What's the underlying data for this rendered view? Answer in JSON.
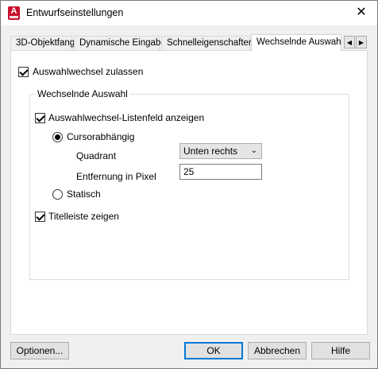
{
  "window": {
    "title": "Entwurfseinstellungen",
    "app_icon_letter": "A",
    "close_symbol": "✕"
  },
  "tabs": [
    {
      "label": "3D-Objektfang",
      "active": false
    },
    {
      "label": "Dynamische Eingabe",
      "active": false
    },
    {
      "label": "Schnelleigenschaften",
      "active": false
    },
    {
      "label": "Wechselnde Auswahl",
      "active": true
    }
  ],
  "tab_scroll": {
    "left": "◀",
    "right": "▶"
  },
  "main": {
    "enable_checkbox": {
      "label": "Auswahlwechsel zulassen",
      "checked": true
    },
    "group": {
      "title": "Wechselnde Auswahl",
      "listbox_checkbox": {
        "label": "Auswahlwechsel-Listenfeld anzeigen",
        "checked": true
      },
      "radio_cursor": {
        "label": "Cursorabhängig",
        "selected": true
      },
      "quadrant": {
        "label": "Quadrant",
        "value": "Unten rechts"
      },
      "distance": {
        "label": "Entfernung in Pixel",
        "value": "25"
      },
      "radio_static": {
        "label": "Statisch",
        "selected": false
      },
      "titlebar_checkbox": {
        "label": "Titelleiste zeigen",
        "checked": true
      }
    }
  },
  "buttons": {
    "options": "Optionen...",
    "ok": "OK",
    "cancel": "Abbrechen",
    "help": "Hilfe"
  },
  "colors": {
    "app_icon": "#c8102e",
    "default_button_border": "#0078d7"
  }
}
